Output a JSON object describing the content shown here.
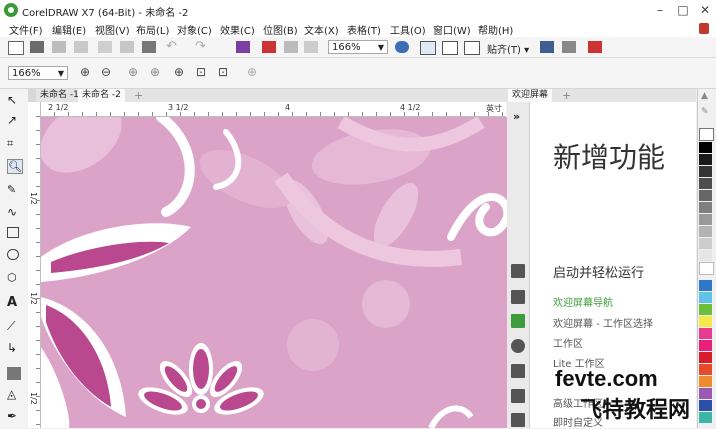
{
  "window": {
    "title": "CorelDRAW X7 (64-Bit) - 未命名 -2"
  },
  "menu": [
    "文件(F)",
    "编辑(E)",
    "视图(V)",
    "布局(L)",
    "对象(C)",
    "效果(C)",
    "位图(B)",
    "文本(X)",
    "表格(T)",
    "工具(O)",
    "窗口(W)",
    "帮助(H)"
  ],
  "toolbar": {
    "zoom_value": "166%",
    "snap_label": "贴齐(T)"
  },
  "propbar": {
    "zoom_value": "166%"
  },
  "doc_tabs": [
    "未命名 -1",
    "未命名 -2"
  ],
  "ruler": {
    "h_labels": [
      "2 1/2",
      "3 1/2",
      "4",
      "4 1/2",
      "英寸"
    ],
    "v_labels": [
      "1/2",
      "1/2",
      "1/2"
    ]
  },
  "docker": {
    "tab": "欢迎屏幕",
    "heading": "新增功能",
    "section": "启动并轻松运行",
    "links": [
      "欢迎屏幕导航",
      "欢迎屏幕 - 工作区选择",
      "工作区",
      "Lite 工作区",
      "高级工作区",
      "即时自定义"
    ]
  },
  "colors": {
    "canvas": "#dba3c8",
    "accent_green": "#3d9c3d",
    "dark_petal": "#b5458f"
  },
  "watermark": {
    "line1": "fevte.com",
    "line2": "飞特教程网"
  }
}
